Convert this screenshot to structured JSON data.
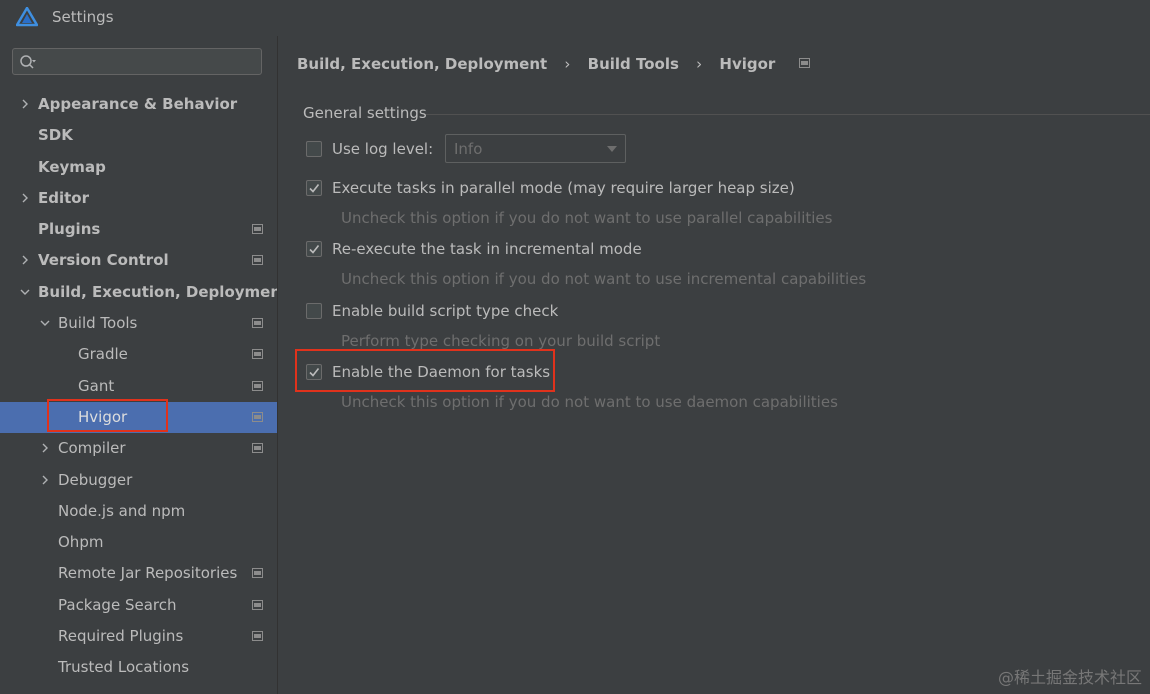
{
  "window": {
    "title": "Settings"
  },
  "search": {
    "placeholder": ""
  },
  "tree": {
    "items": [
      {
        "label": "Appearance & Behavior",
        "bold": true,
        "chevron": "right",
        "indent": 0,
        "proj": false
      },
      {
        "label": "SDK",
        "bold": true,
        "chevron": null,
        "indent": 0,
        "proj": false
      },
      {
        "label": "Keymap",
        "bold": true,
        "chevron": null,
        "indent": 0,
        "proj": false
      },
      {
        "label": "Editor",
        "bold": true,
        "chevron": "right",
        "indent": 0,
        "proj": false
      },
      {
        "label": "Plugins",
        "bold": true,
        "chevron": null,
        "indent": 0,
        "proj": true
      },
      {
        "label": "Version Control",
        "bold": true,
        "chevron": "right",
        "indent": 0,
        "proj": true
      },
      {
        "label": "Build, Execution, Deployment",
        "bold": true,
        "chevron": "down",
        "indent": 0,
        "proj": false
      },
      {
        "label": "Build Tools",
        "bold": false,
        "chevron": "down",
        "indent": 1,
        "proj": true
      },
      {
        "label": "Gradle",
        "bold": false,
        "chevron": null,
        "indent": 2,
        "proj": true
      },
      {
        "label": "Gant",
        "bold": false,
        "chevron": null,
        "indent": 2,
        "proj": true
      },
      {
        "label": "Hvigor",
        "bold": false,
        "chevron": null,
        "indent": 2,
        "proj": true,
        "selected": true
      },
      {
        "label": "Compiler",
        "bold": false,
        "chevron": "right",
        "indent": 1,
        "proj": true
      },
      {
        "label": "Debugger",
        "bold": false,
        "chevron": "right",
        "indent": 1,
        "proj": false
      },
      {
        "label": "Node.js and npm",
        "bold": false,
        "chevron": null,
        "indent": 1,
        "proj": false
      },
      {
        "label": "Ohpm",
        "bold": false,
        "chevron": null,
        "indent": 1,
        "proj": false
      },
      {
        "label": "Remote Jar Repositories",
        "bold": false,
        "chevron": null,
        "indent": 1,
        "proj": true
      },
      {
        "label": "Package Search",
        "bold": false,
        "chevron": null,
        "indent": 1,
        "proj": true
      },
      {
        "label": "Required Plugins",
        "bold": false,
        "chevron": null,
        "indent": 1,
        "proj": true
      },
      {
        "label": "Trusted Locations",
        "bold": false,
        "chevron": null,
        "indent": 1,
        "proj": false
      }
    ]
  },
  "breadcrumb": {
    "part1": "Build, Execution, Deployment",
    "part2": "Build Tools",
    "part3": "Hvigor",
    "separator": "›"
  },
  "general": {
    "title": "General settings",
    "log_level_label": "Use log level:",
    "log_level_value": "Info",
    "log_level_checked": false,
    "parallel_label": "Execute tasks in parallel mode (may require larger heap size)",
    "parallel_checked": true,
    "parallel_hint": "Uncheck this option if you do not want to use parallel capabilities",
    "incremental_label": "Re-execute the task in incremental mode",
    "incremental_checked": true,
    "incremental_hint": "Uncheck this option if you do not want to use incremental capabilities",
    "typecheck_label": "Enable build script type check",
    "typecheck_checked": false,
    "typecheck_hint": "Perform type checking on your build script",
    "daemon_label": "Enable the Daemon for tasks",
    "daemon_checked": true,
    "daemon_hint": "Uncheck this option if you do not want to use daemon capabilities"
  },
  "watermark": "@稀土掘金技术社区",
  "colors": {
    "background": "#3c3f41",
    "selected": "#4b6eaf",
    "highlight": "#e0321c",
    "text": "#bbbbbb",
    "hint": "#6e6e6e"
  }
}
